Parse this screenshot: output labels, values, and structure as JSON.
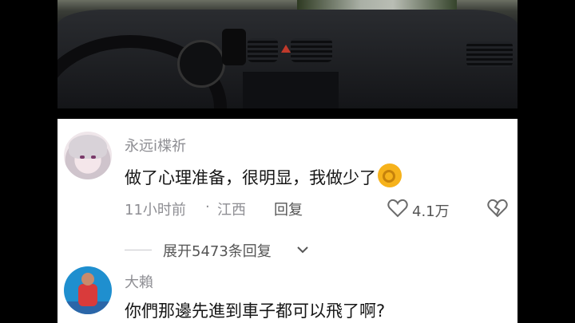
{
  "comments": [
    {
      "username": "永远i楪祈",
      "text": "做了心理准备，很明显，我做少了",
      "emoji_icon": "ok-hand-icon",
      "time": "11小时前",
      "separator": "·",
      "location": "江西",
      "reply_label": "回复",
      "like_count": "4.1万"
    },
    {
      "username": "大賴",
      "text": "你們那邊先進到車子都可以飛了啊?"
    }
  ],
  "expand_replies": "展开5473条回复",
  "colors": {
    "secondary_text": "#8e8e93",
    "primary_text": "#161616",
    "emoji": "#f6b21b"
  }
}
